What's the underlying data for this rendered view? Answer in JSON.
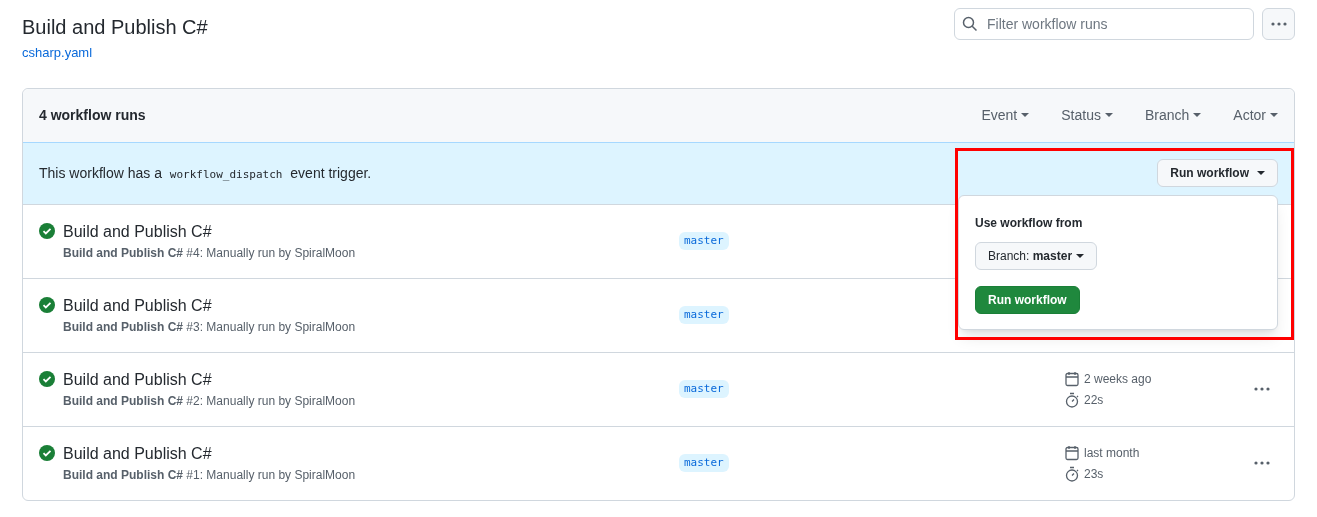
{
  "header": {
    "title": "Build and Publish C#",
    "file_link": "csharp.yaml",
    "search": {
      "placeholder": "Filter workflow runs"
    }
  },
  "runs_box": {
    "count": "4 workflow runs",
    "filters": [
      {
        "label": "Event"
      },
      {
        "label": "Status"
      },
      {
        "label": "Branch"
      },
      {
        "label": "Actor"
      }
    ],
    "banner": {
      "before": "This workflow has a",
      "code": "workflow_dispatch",
      "after": "event trigger.",
      "button": "Run workflow",
      "popup": {
        "open": true,
        "label": "Use workflow from",
        "branch_button": "Branch: **master**",
        "submit": "Run workflow"
      }
    },
    "runs": [
      {
        "title": "Build and Publish C#",
        "subtitle": "**Build and Publish C#** #4: Manually run by SpiralMoon",
        "branch": "master",
        "succeeded": true
      },
      {
        "title": "Build and Publish C#",
        "subtitle": "**Build and Publish C#** #3: Manually run by SpiralMoon",
        "branch": "master",
        "succeeded": true
      },
      {
        "title": "Build and Publish C#",
        "subtitle": "**Build and Publish C#** #2: Manually run by SpiralMoon",
        "branch": "master",
        "succeeded": true,
        "date": "2 weeks ago",
        "duration": "22s"
      },
      {
        "title": "Build and Publish C#",
        "subtitle": "**Build and Publish C#** #1: Manually run by SpiralMoon",
        "branch": "master",
        "succeeded": true,
        "date": "last month",
        "duration": "23s"
      }
    ]
  },
  "highlight": {
    "visible": true
  }
}
